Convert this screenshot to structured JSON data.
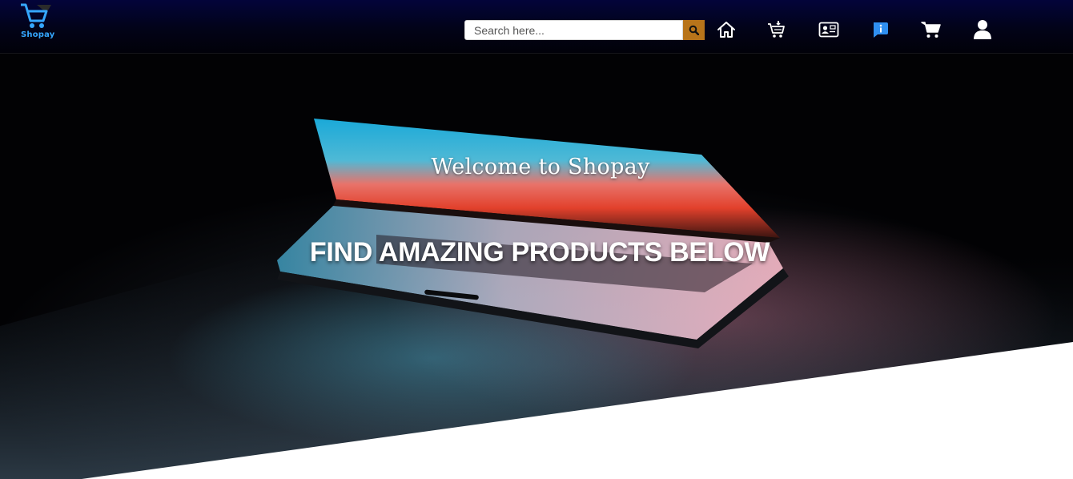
{
  "header": {
    "logo_text": "Shopay",
    "search": {
      "placeholder": "Search here..."
    },
    "icons": [
      "search-icon",
      "home-icon",
      "add-to-cart-icon",
      "contact-card-icon",
      "info-icon",
      "cart-icon",
      "user-icon"
    ],
    "colors": {
      "navbar": "#02032a",
      "search_button": "#b8741a",
      "info_icon": "#2f8ff0",
      "logo": "#35a7ff"
    }
  },
  "hero": {
    "welcome": "Welcome to Shopay",
    "headline": "FIND AMAZING PRODUCTS BELOW"
  }
}
